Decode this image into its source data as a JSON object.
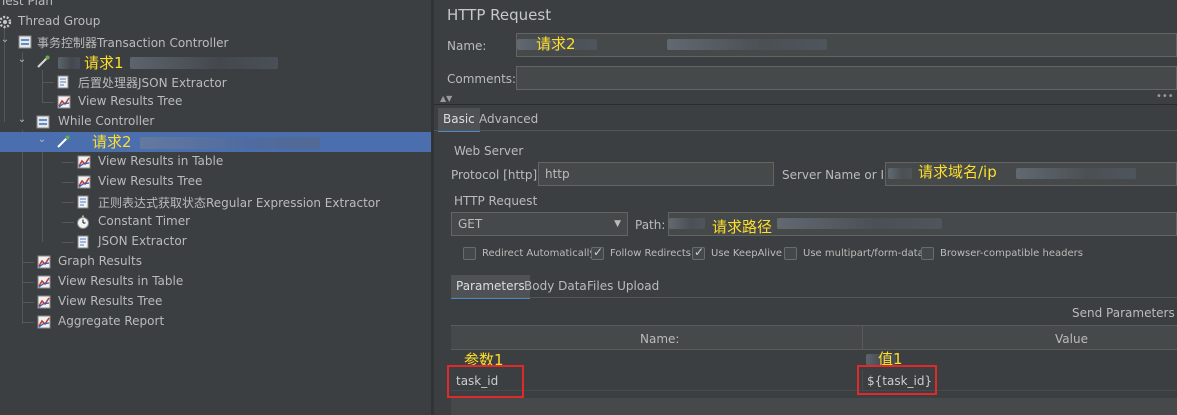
{
  "tree": {
    "test_plan": "Test Plan",
    "thread_group": "Thread Group",
    "transaction_controller": "事务控制器Transaction Controller",
    "request1_label": "请求1",
    "json_extractor_post": "后置处理器JSON Extractor",
    "view_results_tree_1": "View Results Tree",
    "while_controller": "While Controller",
    "request2_label": "请求2",
    "view_results_in_table_1": "View Results in Table",
    "view_results_tree_2": "View Results Tree",
    "regex_extractor": "正则表达式获取状态Regular Expression Extractor",
    "constant_timer": "Constant Timer",
    "json_extractor": "JSON Extractor",
    "graph_results": "Graph Results",
    "view_results_in_table_2": "View Results in Table",
    "view_results_tree_3": "View Results Tree",
    "aggregate_report": "Aggregate Report"
  },
  "panel": {
    "title": "HTTP Request",
    "name_label": "Name:",
    "name_value": "请求2",
    "comments_label": "Comments:",
    "tabs": [
      "Basic",
      "Advanced"
    ],
    "web_server_group": "Web Server",
    "protocol_label": "Protocol [http]:",
    "protocol_value": "http",
    "server_label": "Server Name or IP:",
    "server_value": "请求域名/ip",
    "http_request_group": "HTTP Request",
    "method": "GET",
    "path_label": "Path:",
    "path_value": "请求路径",
    "checkboxes": [
      {
        "label": "Redirect Automatically",
        "checked": false
      },
      {
        "label": "Follow Redirects",
        "checked": true
      },
      {
        "label": "Use KeepAlive",
        "checked": true
      },
      {
        "label": "Use multipart/form-data",
        "checked": false
      },
      {
        "label": "Browser-compatible headers",
        "checked": false
      }
    ],
    "sub_tabs": [
      "Parameters",
      "Body Data",
      "Files Upload"
    ],
    "send_params": "Send Parameters Wi",
    "col_name": "Name:",
    "col_value": "Value",
    "param_annotation": "参数1",
    "value_annotation": "值1",
    "param_name": "task_id",
    "param_value": "${task_id}"
  },
  "colors": {
    "selected": "#4b6eaf",
    "annotation": "#ffde2a",
    "highlight_box": "#e0292a"
  }
}
